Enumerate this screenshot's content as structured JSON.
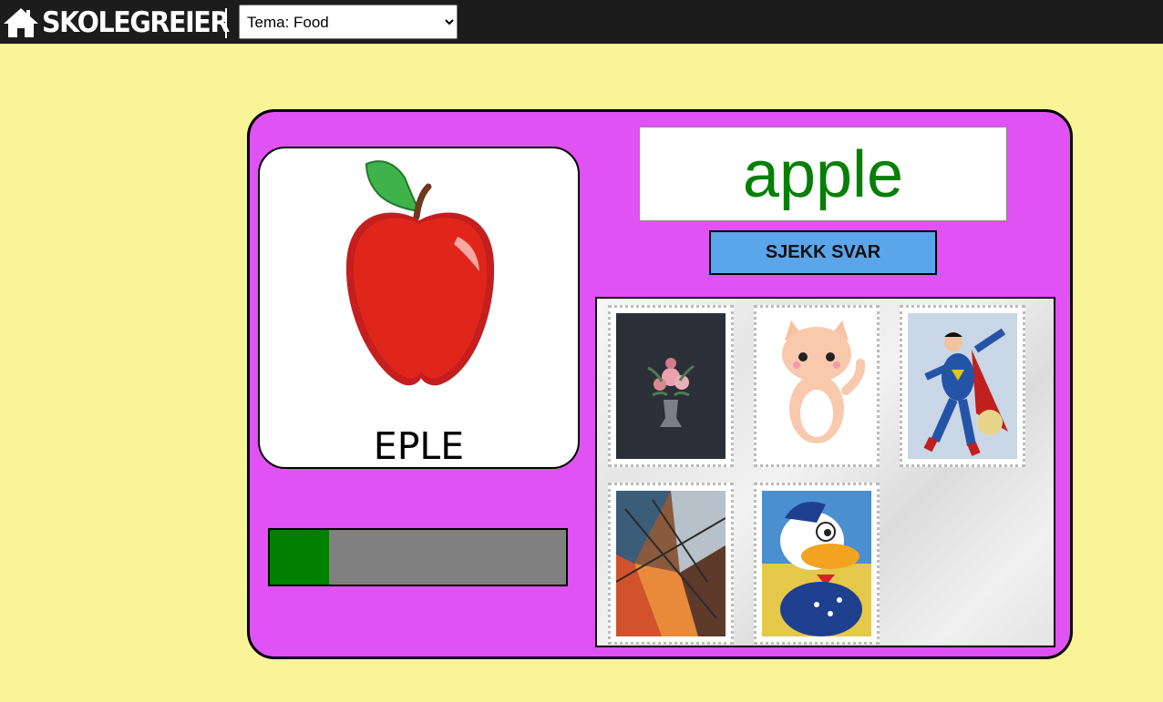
{
  "header": {
    "logo_text": "SKOLEGREIER",
    "logo_icon": "house-icon",
    "theme_select": {
      "selected": "Tema: Food"
    }
  },
  "flashcard": {
    "image": "apple-image",
    "word": "EPLE"
  },
  "answer": {
    "value": "apple",
    "check_label": "SJEKK SVAR"
  },
  "progress": {
    "fraction": 0.2
  },
  "stamps": [
    {
      "name": "stamp-flower-vase"
    },
    {
      "name": "stamp-cat"
    },
    {
      "name": "stamp-superman"
    },
    {
      "name": "stamp-abstract-painting"
    },
    {
      "name": "stamp-donald-duck"
    }
  ],
  "colors": {
    "topbar": "#1c1c1c",
    "background": "#f9f497",
    "card": "#e052f3",
    "answer_text": "#058005",
    "button": "#5ba5ea",
    "progress_fill": "#008000",
    "progress_track": "#808080"
  }
}
